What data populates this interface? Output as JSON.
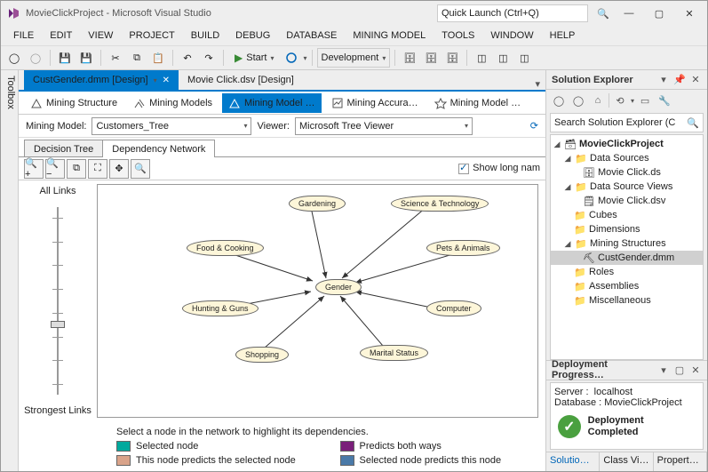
{
  "window": {
    "title": "MovieClickProject - Microsoft Visual Studio",
    "quick_launch_placeholder": "Quick Launch (Ctrl+Q)"
  },
  "menu": {
    "file": "FILE",
    "edit": "EDIT",
    "view": "VIEW",
    "project": "PROJECT",
    "build": "BUILD",
    "debug": "DEBUG",
    "database": "DATABASE",
    "mining": "MINING MODEL",
    "tools": "TOOLS",
    "window": "WINDOW",
    "help": "HELP"
  },
  "toolbar": {
    "start": "Start",
    "config": "Development"
  },
  "toolbox": {
    "label": "Toolbox"
  },
  "docs": {
    "active": "CustGender.dmm [Design]",
    "inactive": "Movie Click.dsv [Design]"
  },
  "mining_tabs": {
    "structure": "Mining Structure",
    "models": "Mining Models",
    "viewer": "Mining Model …",
    "accuracy": "Mining Accura…",
    "prediction": "Mining Model …"
  },
  "model_row": {
    "mining_model_label": "Mining Model:",
    "mining_model_value": "Customers_Tree",
    "viewer_label": "Viewer:",
    "viewer_value": "Microsoft Tree Viewer"
  },
  "subtabs": {
    "decision": "Decision Tree",
    "dependency": "Dependency Network"
  },
  "dep_toolbar": {
    "show_long": "Show long nam"
  },
  "slider": {
    "top": "All Links",
    "bottom": "Strongest Links"
  },
  "nodes": {
    "gardening": "Gardening",
    "science": "Science & Technology",
    "food": "Food & Cooking",
    "pets": "Pets & Animals",
    "gender": "Gender",
    "hunting": "Hunting & Guns",
    "computer": "Computer",
    "shopping": "Shopping",
    "marital": "Marital Status"
  },
  "legend": {
    "hint": "Select a node in the network to highlight its dependencies.",
    "selected": "Selected node",
    "predicts_selected": "This node predicts the selected node",
    "both": "Predicts both ways",
    "selected_predicts": "Selected node predicts this node"
  },
  "solution_explorer": {
    "title": "Solution Explorer",
    "search_placeholder": "Search Solution Explorer (C",
    "project": "MovieClickProject",
    "data_sources": "Data Sources",
    "ds_item": "Movie Click.ds",
    "data_source_views": "Data Source Views",
    "dsv_item": "Movie Click.dsv",
    "cubes": "Cubes",
    "dimensions": "Dimensions",
    "mining_structures": "Mining Structures",
    "ms_item": "CustGender.dmm",
    "roles": "Roles",
    "assemblies": "Assemblies",
    "misc": "Miscellaneous"
  },
  "deployment": {
    "title": "Deployment Progress…",
    "server_label": "Server :",
    "server": "localhost",
    "db_label": "Database :",
    "db": "MovieClickProject",
    "status": "Deployment Completed"
  },
  "bottom_tabs": {
    "solution": "Solutio…",
    "class": "Class Vi…",
    "properties": "Propert…"
  },
  "colors": {
    "sw_selected": "#00a99d",
    "sw_predicts_sel": "#d9a38a",
    "sw_both": "#7a1f7a",
    "sw_sel_predicts": "#4a7aa8"
  }
}
